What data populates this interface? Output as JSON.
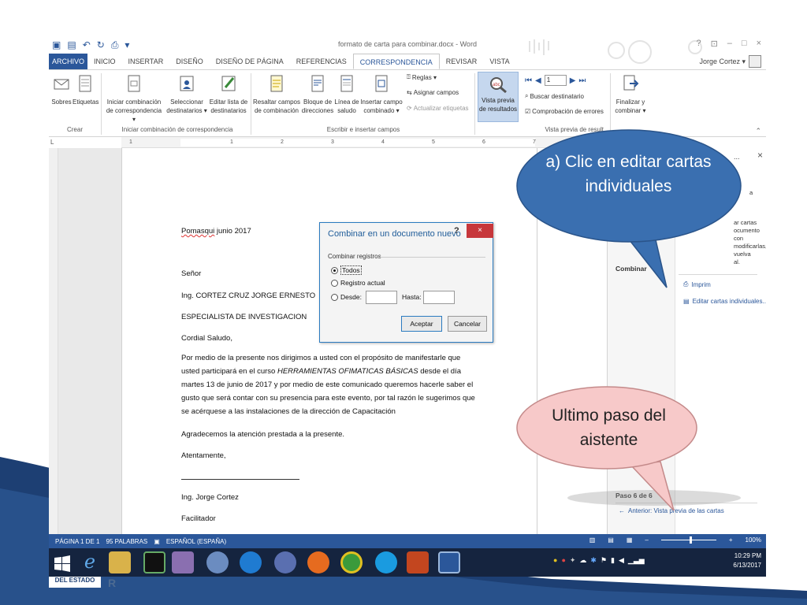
{
  "window": {
    "title": "formato de carta para combinar.docx - Word",
    "help": "?",
    "restore_ribbon": "⊡",
    "minimize": "–",
    "maximize": "□",
    "close": "×",
    "user_name": "Jorge Cortez ▾"
  },
  "tabs": [
    "ARCHIVO",
    "INICIO",
    "INSERTAR",
    "DISEÑO",
    "DISEÑO DE PÁGINA",
    "REFERENCIAS",
    "CORRESPONDENCIA",
    "REVISAR",
    "VISTA"
  ],
  "active_tab": "CORRESPONDENCIA",
  "ribbon": {
    "sobres": "Sobres",
    "etiquetas": "Etiquetas",
    "crear_group": "Crear",
    "iniciar_1": "Iniciar combinación",
    "iniciar_2": "de correspondencia ▾",
    "seleccionar_1": "Seleccionar",
    "seleccionar_2": "destinatarios ▾",
    "editar_1": "Editar lista de",
    "editar_2": "destinatarios",
    "iniciar_group": "Iniciar combinación de correspondencia",
    "resaltar_1": "Resaltar campos",
    "resaltar_2": "de combinación",
    "bloque_1": "Bloque de",
    "bloque_2": "direcciones",
    "linea_1": "Línea de",
    "linea_2": "saludo",
    "insertar_1": "Insertar campo",
    "insertar_2": "combinado ▾",
    "reglas": "Reglas ▾",
    "asignar": "Asignar campos",
    "actualizar": "Actualizar etiquetas",
    "escribir_group": "Escribir e insertar campos",
    "vista_1": "Vista previa",
    "vista_2": "de resultados",
    "record": "1",
    "buscar": "Buscar destinatario",
    "comprobacion": "Comprobación de errores",
    "vista_group": "Vista previa de result",
    "finalizar_1": "Finalizar y",
    "finalizar_2": "combinar ▾",
    "collapse": "⌃"
  },
  "ruler": {
    "corner": "L",
    "ticks": [
      "1",
      "1",
      "2",
      "3",
      "4",
      "5",
      "6",
      "7"
    ]
  },
  "document": {
    "date_place": "Pomasqui",
    "date_rest": "junio 2017",
    "senor": "Señor",
    "name": "Ing. CORTEZ CRUZ JORGE ERNESTO",
    "role": "ESPECIALISTA DE INVESTIGACION",
    "greeting": "Cordial Saludo,",
    "body_1": "Por medio de la presente nos dirigimos a usted con el propósito de manifestarle que usted participará en el curso ",
    "body_course": "HERRAMIENTAS OFIMATICAS BÁSICAS",
    "body_2": " desde el día martes 13 de junio de 2017 y por medio de este comunicado queremos hacerle saber el gusto que será contar con su presencia para este evento, por tal razón le sugerimos que se acérquese a las instalaciones de la dirección de Capacitación",
    "thanks": "Agradecemos la atención prestada a la presente.",
    "closing": "Atentamente,",
    "signer": "Ing. Jorge Cortez",
    "signer_role": "Facilitador"
  },
  "pane": {
    "title_frag": "...",
    "close": "×",
    "frag_line_0": "a",
    "frag_line_1": "ar cartas",
    "frag_line_2": "ocumento con",
    "frag_line_3": "modificarlas, vuelva",
    "frag_line_4": "al.",
    "combinar_frag": "Combinar",
    "imprimir_frag": "Imprim",
    "editar_cartas": "Editar cartas individuales...",
    "step": "Paso 6 de 6",
    "back_link": "Anterior: Vista previa de las cartas"
  },
  "status": {
    "page": "PÁGINA 1 DE 1",
    "words": "95 PALABRAS",
    "language": "ESPAÑOL (ESPAÑA)",
    "zoom": "100%",
    "zoom_minus": "–",
    "zoom_plus": "+"
  },
  "dialog": {
    "title": "Combinar en un documento nuevo",
    "help": "?",
    "close": "×",
    "group": "Combinar registros",
    "todos": "Todos",
    "registro": "Registro actual",
    "desde": "Desde:",
    "hasta": "Hasta:",
    "accept": "Aceptar",
    "cancel": "Cancelar",
    "selected": "todos"
  },
  "taskbar": {
    "time": "10:29 PM",
    "date": "6/13/2017"
  },
  "callouts": {
    "blue": "a) Clic en editar cartas individuales",
    "pink": "Ultimo paso del aistente"
  },
  "slide": {
    "logo_text": "DEL ESTADO",
    "mark": "R"
  },
  "colors": {
    "word_blue": "#2b579a",
    "callout_blue": "#3a6fb0",
    "callout_pink": "#f7c9c9",
    "dialog_close": "#c7373b"
  }
}
